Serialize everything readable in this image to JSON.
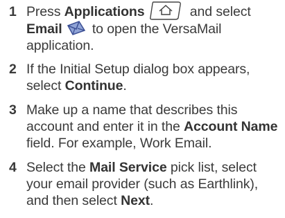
{
  "steps": [
    {
      "num": "1",
      "t1": "Press ",
      "b1": "Applications",
      "t2": " and select",
      "b2": "Email",
      "t3": " to open the VersaMail application."
    },
    {
      "num": "2",
      "t1": "If the Initial Setup dialog box appears, select ",
      "b1": "Continue",
      "t2": "."
    },
    {
      "num": "3",
      "t1": "Make up a name that describes this account and enter it in the ",
      "b1": "Account Name",
      "t2": " field. For example, Work Email."
    },
    {
      "num": "4",
      "t1": "Select the ",
      "b1": "Mail Service",
      "t2": " pick list, select your email provider (such as Earthlink), and then select ",
      "b2": "Next",
      "t3": "."
    }
  ],
  "icons": {
    "applications": "applications-button-icon",
    "email": "email-envelope-icon"
  },
  "colors": {
    "text": "#3a3a3a",
    "icon_envelope": "#5a6fb0"
  }
}
